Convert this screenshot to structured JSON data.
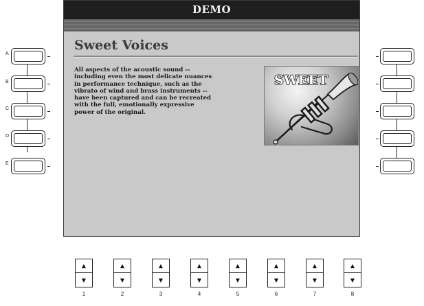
{
  "screen": {
    "title": "DEMO",
    "content_title": "Sweet Voices",
    "content_text": "All aspects of the acoustic sound --\nincluding even the most delicate nuances\nin performance technique, such as the\nvibrato of wind and brass instruments --\nhave been captured and can be recreated\nwith the full, emotionally expressive\npower of the original.",
    "image_caption": "SWEET"
  },
  "left_buttons": [
    {
      "label": "A"
    },
    {
      "label": "B"
    },
    {
      "label": "C"
    },
    {
      "label": "D"
    },
    {
      "label": "E"
    }
  ],
  "right_buttons": [
    {
      "label": ""
    },
    {
      "label": ""
    },
    {
      "label": ""
    },
    {
      "label": ""
    },
    {
      "label": ""
    }
  ],
  "bottom_buttons": [
    {
      "number": "1",
      "up": "▲",
      "down": "▼"
    },
    {
      "number": "2",
      "up": "▲",
      "down": "▼"
    },
    {
      "number": "3",
      "up": "▲",
      "down": "▼"
    },
    {
      "number": "4",
      "up": "▲",
      "down": "▼"
    },
    {
      "number": "5",
      "up": "▲",
      "down": "▼"
    },
    {
      "number": "6",
      "up": "▲",
      "down": "▼"
    },
    {
      "number": "7",
      "up": "▲",
      "down": "▼"
    },
    {
      "number": "8",
      "up": "▲",
      "down": "▼"
    }
  ],
  "colors": {
    "screen_bg": "#c9c9c9",
    "titlebar_bg": "#1e1e1e",
    "titlebar_text": "#f2f2f2"
  }
}
